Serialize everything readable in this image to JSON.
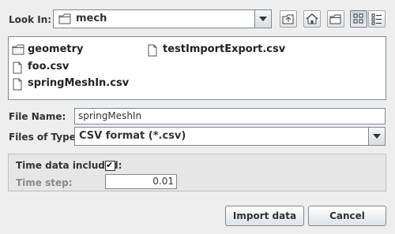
{
  "look_in": {
    "label": "Look In:",
    "value": "mech"
  },
  "toolbar": {
    "up_icon": "up-folder-icon",
    "home_icon": "home-icon",
    "new_folder_icon": "new-folder-icon",
    "list_view_icon": "list-view-icon",
    "details_view_icon": "details-view-icon"
  },
  "files": [
    {
      "name": "geometry",
      "type": "folder"
    },
    {
      "name": "foo.csv",
      "type": "file"
    },
    {
      "name": "springMeshIn.csv",
      "type": "file"
    },
    {
      "name": "testImportExport.csv",
      "type": "file"
    }
  ],
  "file_name": {
    "label": "File Name:",
    "value": "springMeshIn"
  },
  "file_type": {
    "label": "Files of Type:",
    "value": "CSV format (*.csv)"
  },
  "options": {
    "time_data_label": "Time data included:",
    "time_data_checked": true,
    "check_mark": "✔",
    "time_step_label": "Time step:",
    "time_step_value": "0.01"
  },
  "buttons": {
    "import": "Import data",
    "cancel": "Cancel"
  }
}
